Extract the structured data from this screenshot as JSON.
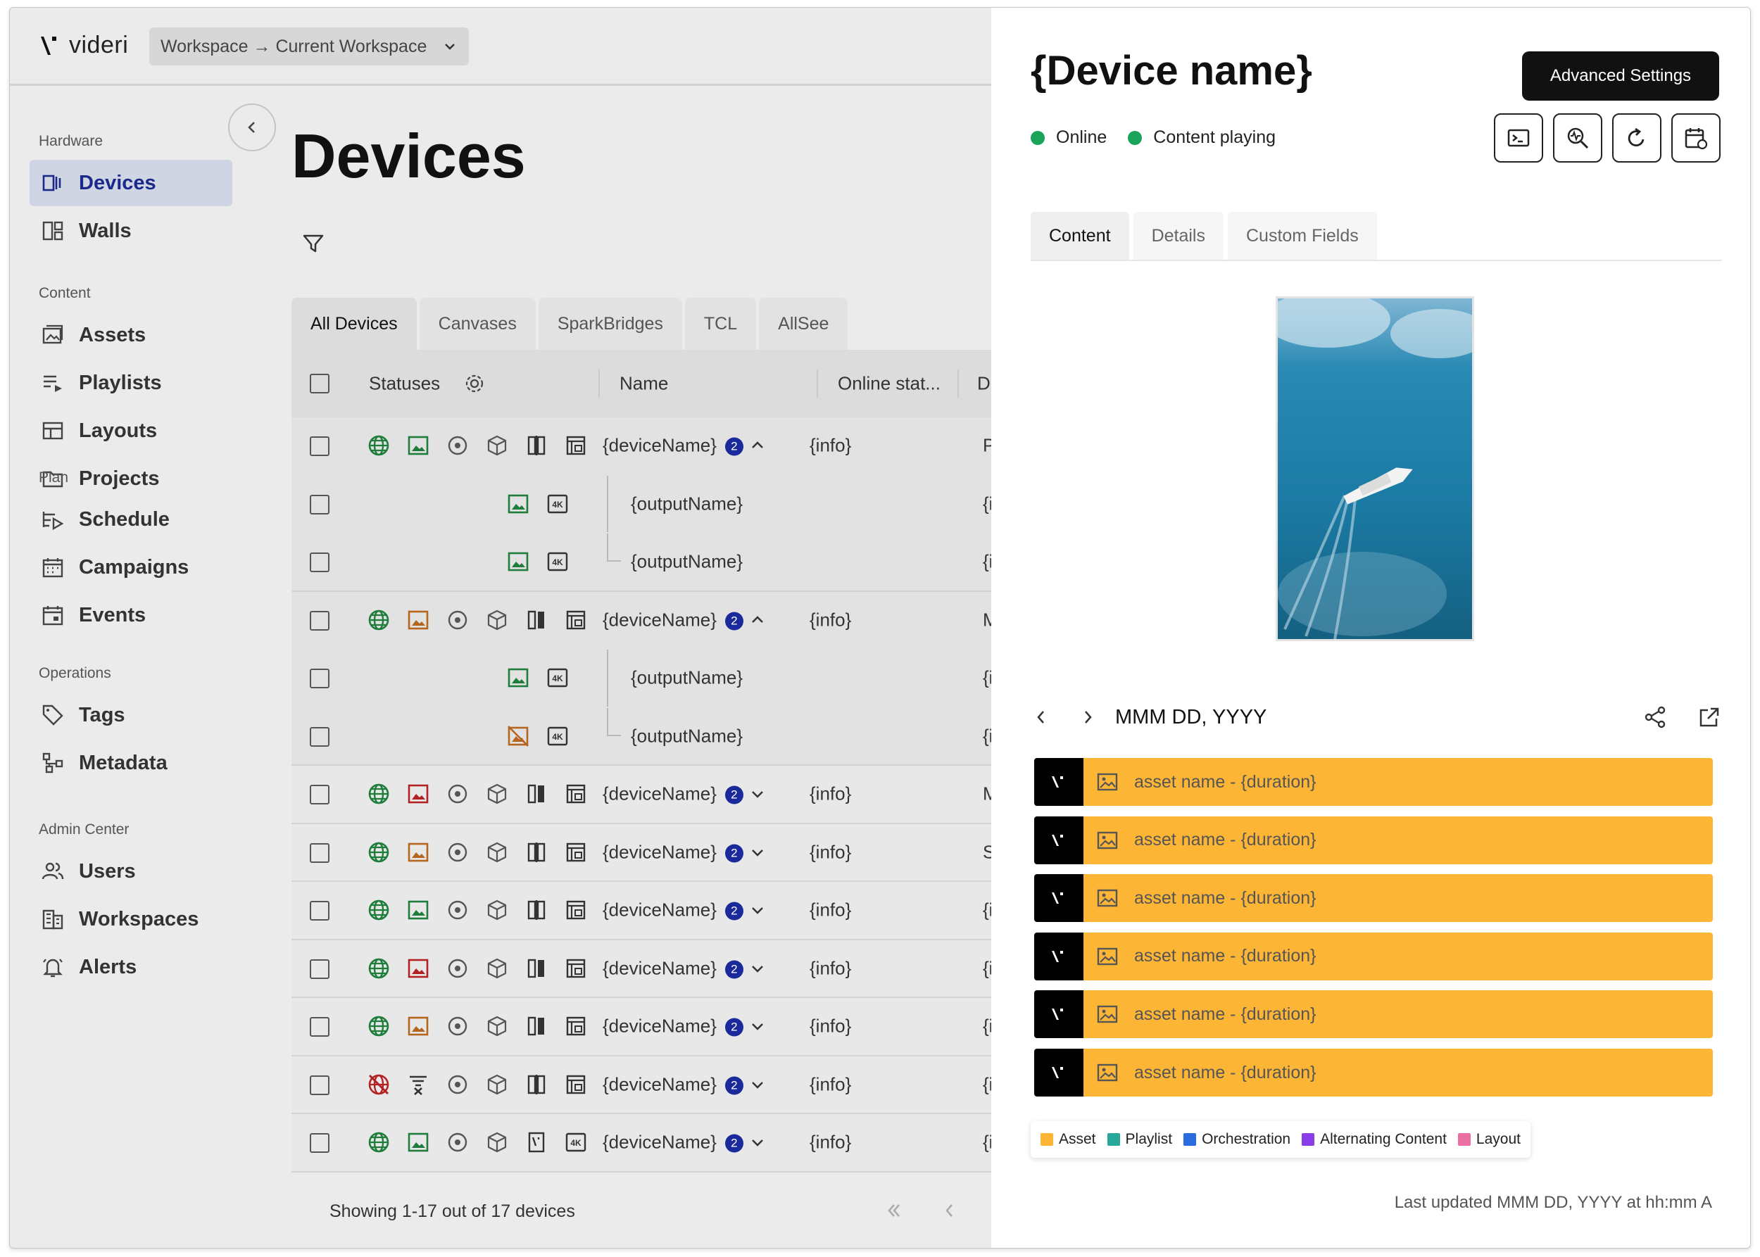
{
  "app": {
    "brand": "videri",
    "workspace": "Workspace → Current Workspace"
  },
  "sidebar": {
    "sections": [
      {
        "label": "Hardware",
        "items": [
          {
            "label": "Devices",
            "icon": "devices-icon",
            "active": true
          },
          {
            "label": "Walls",
            "icon": "walls-icon"
          }
        ]
      },
      {
        "label": "Content",
        "items": [
          {
            "label": "Assets",
            "icon": "assets-icon"
          },
          {
            "label": "Playlists",
            "icon": "playlists-icon"
          },
          {
            "label": "Layouts",
            "icon": "layouts-icon"
          },
          {
            "label": "Projects",
            "icon": "folder-icon"
          }
        ]
      },
      {
        "label": "Plan",
        "items": [
          {
            "label": "Schedule",
            "icon": "schedule-icon"
          },
          {
            "label": "Campaigns",
            "icon": "calendar-icon"
          },
          {
            "label": "Events",
            "icon": "event-icon"
          }
        ]
      },
      {
        "label": "Operations",
        "items": [
          {
            "label": "Tags",
            "icon": "tag-icon"
          },
          {
            "label": "Metadata",
            "icon": "metadata-icon"
          }
        ]
      },
      {
        "label": "Admin Center",
        "items": [
          {
            "label": "Users",
            "icon": "users-icon"
          },
          {
            "label": "Workspaces",
            "icon": "workspaces-icon"
          },
          {
            "label": "Alerts",
            "icon": "bell-icon"
          }
        ]
      }
    ]
  },
  "main": {
    "title": "Devices",
    "tabs": [
      "All Devices",
      "Canvases",
      "SparkBridges",
      "TCL",
      "AllSee"
    ],
    "columns": {
      "statuses": "Statuses",
      "name": "Name",
      "online": "Online stat...",
      "display": "Dis"
    },
    "badge": "2",
    "rows": [
      {
        "kind": "device",
        "name": "{deviceName}",
        "info": "{info}",
        "display": "Pla",
        "expanded": true,
        "image_color": "#1e7d3a",
        "wall": "outline",
        "last": "canvas"
      },
      {
        "kind": "output",
        "name": "{outputName}",
        "display": "{in",
        "image_color": "#1e7d3a"
      },
      {
        "kind": "output",
        "name": "{outputName}",
        "display": "{in",
        "image_color": "#1e7d3a",
        "sep": true
      },
      {
        "kind": "device",
        "name": "{deviceName}",
        "info": "{info}",
        "display": "Mi",
        "expanded": true,
        "image_color": "#b5651d",
        "wall": "half",
        "last": "canvas"
      },
      {
        "kind": "output",
        "name": "{outputName}",
        "display": "{in",
        "image_color": "#1e7d3a"
      },
      {
        "kind": "output",
        "name": "{outputName}",
        "display": "{in",
        "image_color": "#b5651d",
        "slash": true,
        "sep": true
      },
      {
        "kind": "device",
        "name": "{deviceName}",
        "info": "{info}",
        "display": "Mi",
        "image_color": "#b22222",
        "wall": "half",
        "last": "canvas"
      },
      {
        "kind": "device",
        "name": "{deviceName}",
        "info": "{info}",
        "display": "Sh",
        "image_color": "#b5651d",
        "wall": "outline",
        "last": "canvas"
      },
      {
        "kind": "device",
        "name": "{deviceName}",
        "info": "{info}",
        "display": "{in",
        "image_color": "#1e7d3a",
        "wall": "outline",
        "last": "canvas"
      },
      {
        "kind": "device",
        "name": "{deviceName}",
        "info": "{info}",
        "display": "{in",
        "image_color": "#b22222",
        "wall": "half",
        "last": "canvas"
      },
      {
        "kind": "device",
        "name": "{deviceName}",
        "info": "{info}",
        "display": "{in",
        "image_color": "#b5651d",
        "wall": "half",
        "last": "canvas"
      },
      {
        "kind": "device",
        "name": "{deviceName}",
        "info": "{info}",
        "display": "{in",
        "image_color": "#b22222",
        "offline": true,
        "wall": "outline",
        "last": "canvas"
      },
      {
        "kind": "device",
        "name": "{deviceName}",
        "info": "{info}",
        "display": "{in",
        "image_color": "#1e7d3a",
        "wall": "logo",
        "last": "4k"
      }
    ],
    "footer": "Showing 1-17 out of 17 devices"
  },
  "panel": {
    "title": "{Device name}",
    "advanced": "Advanced Settings",
    "status_online": "Online",
    "status_content": "Content playing",
    "tabs": [
      "Content",
      "Details",
      "Custom Fields"
    ],
    "date": "MMM DD, YYYY",
    "assets": [
      "asset name - {duration}",
      "asset name - {duration}",
      "asset name - {duration}",
      "asset name - {duration}",
      "asset name - {duration}",
      "asset name - {duration}"
    ],
    "legend": [
      {
        "label": "Asset",
        "color": "#fdb535"
      },
      {
        "label": "Playlist",
        "color": "#26a89a"
      },
      {
        "label": "Orchestration",
        "color": "#2a6be0"
      },
      {
        "label": "Alternating Content",
        "color": "#8a3ee8"
      },
      {
        "label": "Layout",
        "color": "#ec6fa3"
      }
    ],
    "updated": "Last updated MMM DD, YYYY at hh:mm A"
  }
}
